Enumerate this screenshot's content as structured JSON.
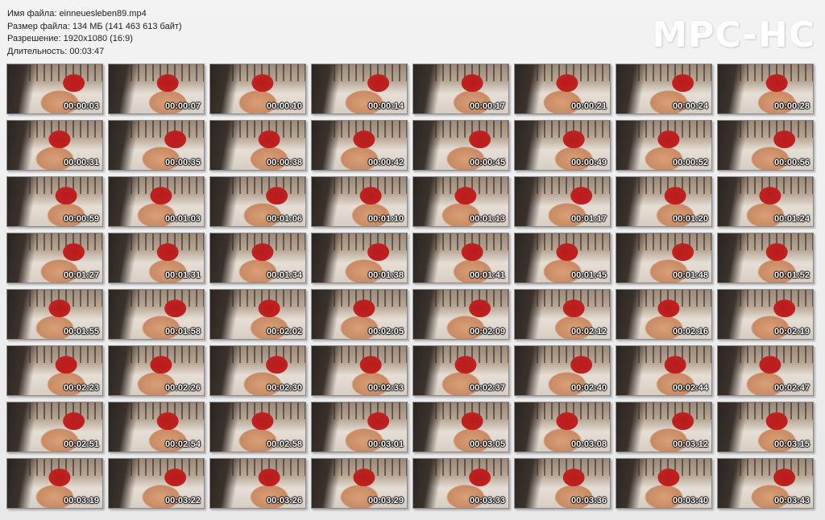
{
  "info": {
    "file_name": "Имя файла: einneuesleben89.mp4",
    "file_size": "Размер файла: 134 МБ (141 463 613 байт)",
    "resolution": "Разрешение: 1920x1080 (16:9)",
    "duration": "Длительность: 00:03:47"
  },
  "logo": "MPC-HC",
  "thumbnails": [
    "00:00:03",
    "00:00:07",
    "00:00:10",
    "00:00:14",
    "00:00:17",
    "00:00:21",
    "00:00:24",
    "00:00:28",
    "00:00:31",
    "00:00:35",
    "00:00:38",
    "00:00:42",
    "00:00:45",
    "00:00:49",
    "00:00:52",
    "00:00:56",
    "00:00:59",
    "00:01:03",
    "00:01:06",
    "00:01:10",
    "00:01:13",
    "00:01:17",
    "00:01:20",
    "00:01:24",
    "00:01:27",
    "00:01:31",
    "00:01:34",
    "00:01:38",
    "00:01:41",
    "00:01:45",
    "00:01:48",
    "00:01:52",
    "00:01:55",
    "00:01:58",
    "00:02:02",
    "00:02:05",
    "00:02:09",
    "00:02:12",
    "00:02:16",
    "00:02:19",
    "00:02:23",
    "00:02:26",
    "00:02:30",
    "00:02:33",
    "00:02:37",
    "00:02:40",
    "00:02:44",
    "00:02:47",
    "00:02:51",
    "00:02:54",
    "00:02:58",
    "00:03:01",
    "00:03:05",
    "00:03:08",
    "00:03:12",
    "00:03:15",
    "00:03:19",
    "00:03:22",
    "00:03:26",
    "00:03:29",
    "00:03:33",
    "00:03:36",
    "00:03:40",
    "00:03:43"
  ]
}
